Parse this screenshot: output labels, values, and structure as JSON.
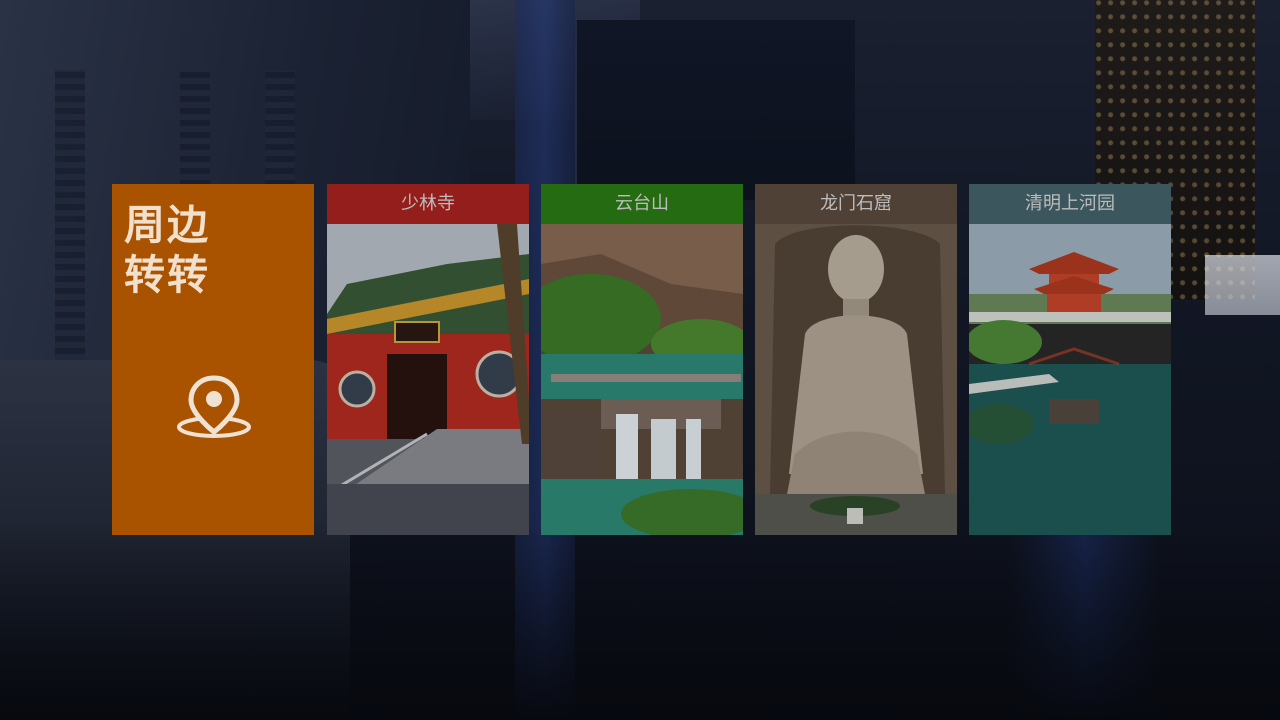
{
  "main_tile": {
    "title_line1": "周边",
    "title_line2": "转转",
    "icon": "location-pin-icon",
    "color": "#a95200"
  },
  "destinations": [
    {
      "name": "少林寺",
      "header_color": "#a8231f",
      "photo": "shaolin-temple-photo"
    },
    {
      "name": "云台山",
      "header_color": "#2b7a14",
      "photo": "yuntai-mountain-photo"
    },
    {
      "name": "龙门石窟",
      "header_color": "#5a4a3e",
      "photo": "longmen-grottoes-photo"
    },
    {
      "name": "清明上河园",
      "header_color": "#44626a",
      "photo": "qingming-garden-photo"
    }
  ]
}
